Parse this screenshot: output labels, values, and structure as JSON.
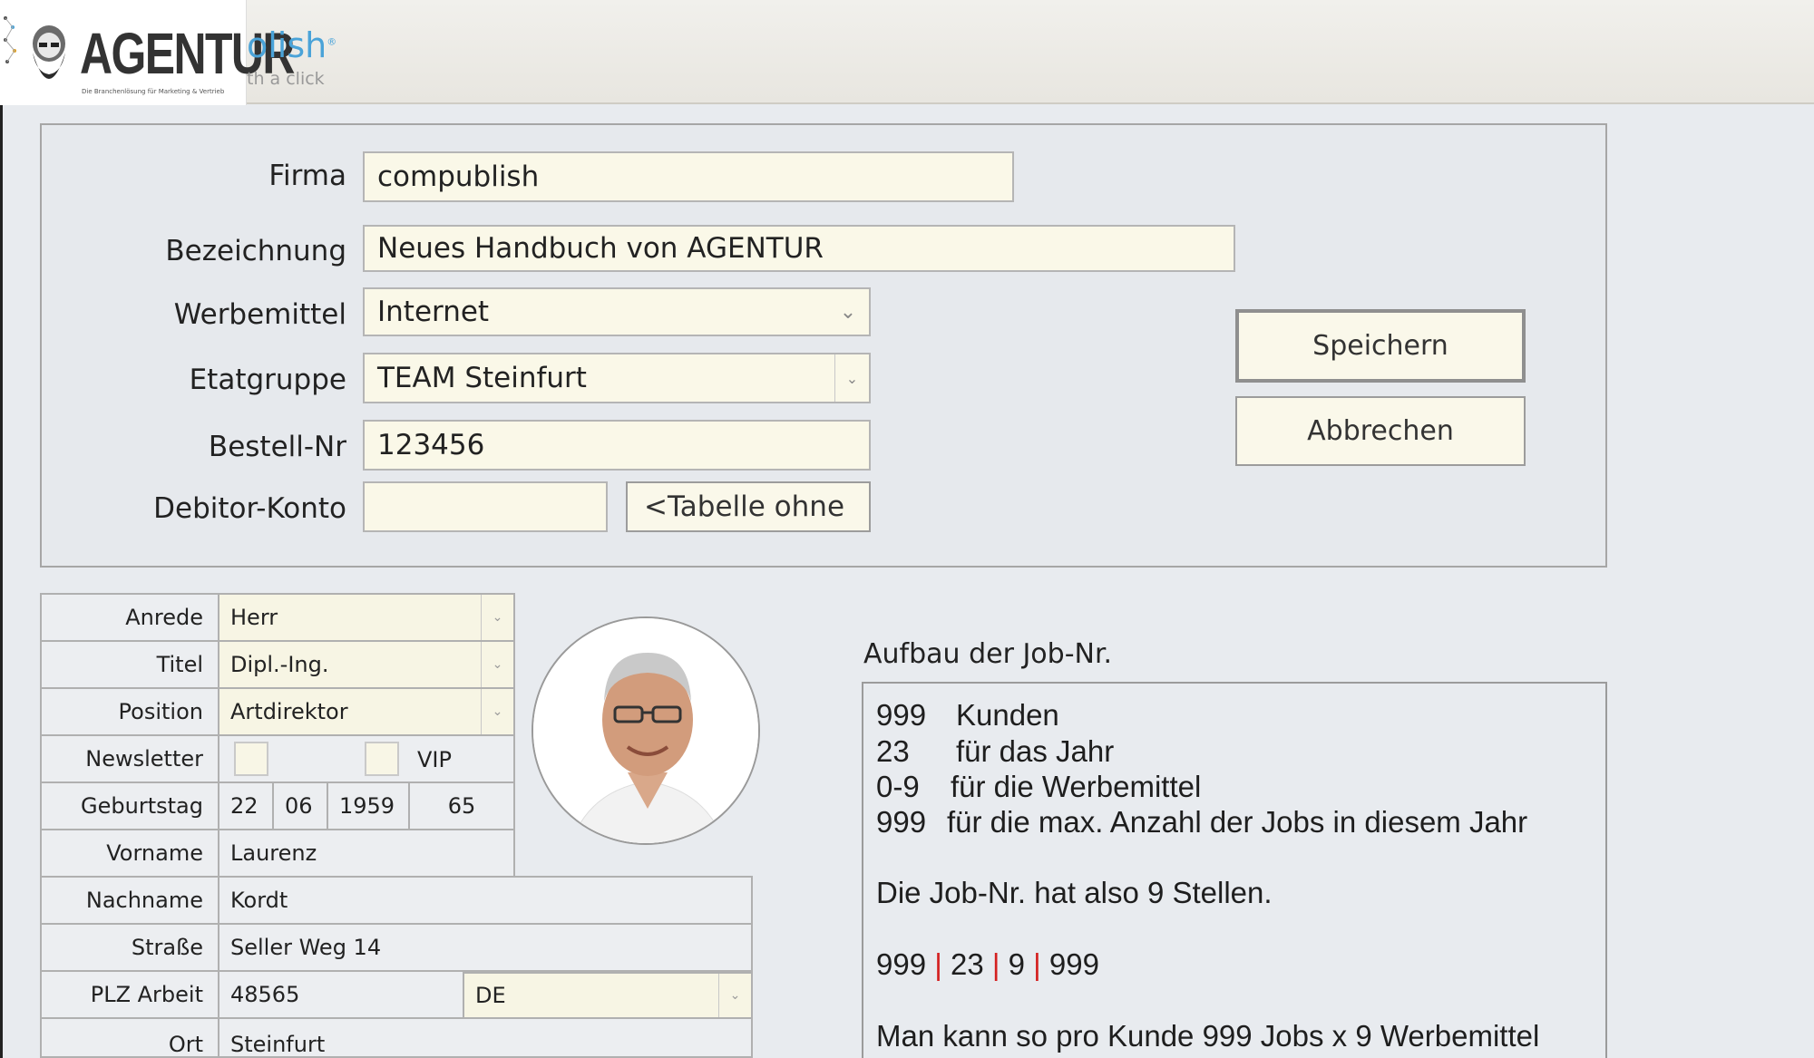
{
  "header": {
    "logo_text": "AGENTUR",
    "logo_subtitle": "Die Branchenlösung für Marketing & Vertrieb",
    "brand_partial": "olish",
    "brand_reg": "®",
    "brand_tagline": "th a click"
  },
  "form": {
    "firma_label": "Firma",
    "firma_value": "compublish",
    "bezeichnung_label": "Bezeichnung",
    "bezeichnung_value": "Neues Handbuch von AGENTUR",
    "werbemittel_label": "Werbemittel",
    "werbemittel_value": "Internet",
    "etatgruppe_label": "Etatgruppe",
    "etatgruppe_value": "TEAM Steinfurt",
    "bestellnr_label": "Bestell-Nr",
    "bestellnr_value": "123456",
    "debitor_label": "Debitor-Konto",
    "debitor_value": "",
    "tabelle_button": "<Tabelle ohne",
    "save_button": "Speichern",
    "cancel_button": "Abbrechen"
  },
  "contact": {
    "anrede_label": "Anrede",
    "anrede_value": "Herr",
    "titel_label": "Titel",
    "titel_value": "Dipl.-Ing.",
    "position_label": "Position",
    "position_value": "Artdirektor",
    "newsletter_label": "Newsletter",
    "vip_label": "VIP",
    "geburtstag_label": "Geburtstag",
    "birth_day": "22",
    "birth_month": "06",
    "birth_year": "1959",
    "age": "65",
    "vorname_label": "Vorname",
    "vorname_value": "Laurenz",
    "nachname_label": "Nachname",
    "nachname_value": "Kordt",
    "strasse_label": "Straße",
    "strasse_value": "Seller Weg 14",
    "plz_label": "PLZ Arbeit",
    "plz_value": "48565",
    "country_value": "DE",
    "ort_label": "Ort",
    "ort_value": "Steinfurt"
  },
  "jobnr": {
    "title": "Aufbau der Job-Nr.",
    "line1_num": "999",
    "line1_text": "Kunden",
    "line2_num": "23",
    "line2_text": "für das Jahr",
    "line3_num": "0-9",
    "line3_text": "für die Werbemittel",
    "line4_num": "999",
    "line4_text": "für die max. Anzahl der Jobs in diesem Jahr",
    "summary": "Die Job-Nr. hat also 9 Stellen.",
    "seg1": "999",
    "seg2": "23",
    "seg3": "9",
    "seg4": "999",
    "sep": "|",
    "footer": "Man kann so pro Kunde 999 Jobs x 9 Werbemittel"
  },
  "colors": {
    "field_bg": "#faf8e8",
    "accent_blue": "#4aa3d8",
    "pipe_red": "#d42020"
  }
}
